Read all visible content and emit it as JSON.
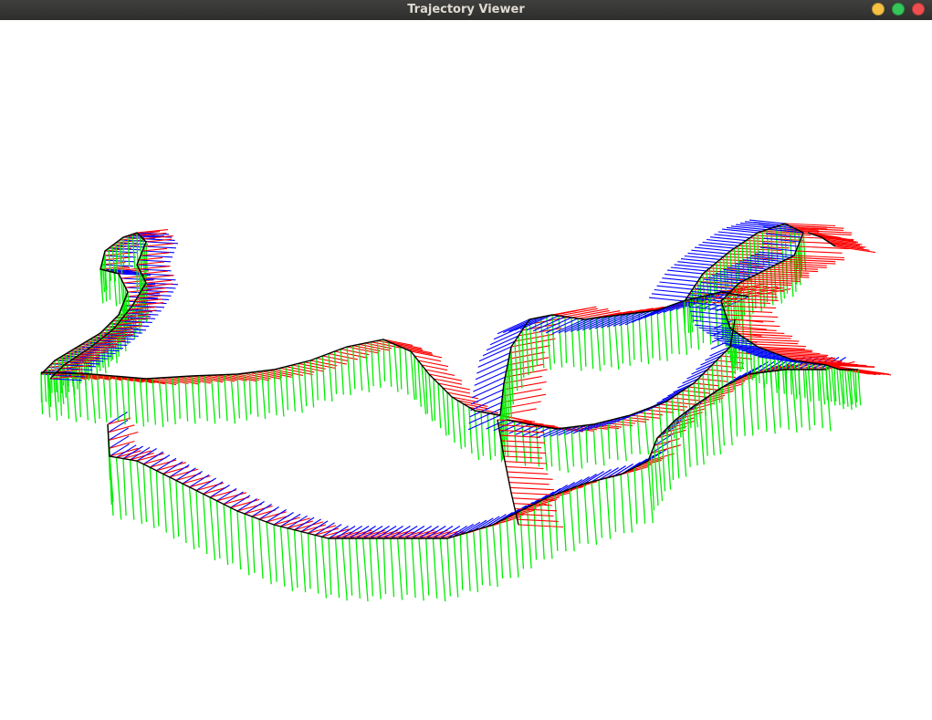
{
  "window": {
    "title": "Trajectory Viewer",
    "controls": [
      {
        "name": "minimize-button",
        "color": "#f6c143"
      },
      {
        "name": "maximize-button",
        "color": "#35c659"
      },
      {
        "name": "close-button",
        "color": "#ee4e4e"
      }
    ]
  },
  "viewer": {
    "background": "#ffffff",
    "path_color": "#000000",
    "axis_colors": {
      "x": "#ff0000",
      "y": "#00ee00",
      "z": "#0000ff"
    }
  }
}
